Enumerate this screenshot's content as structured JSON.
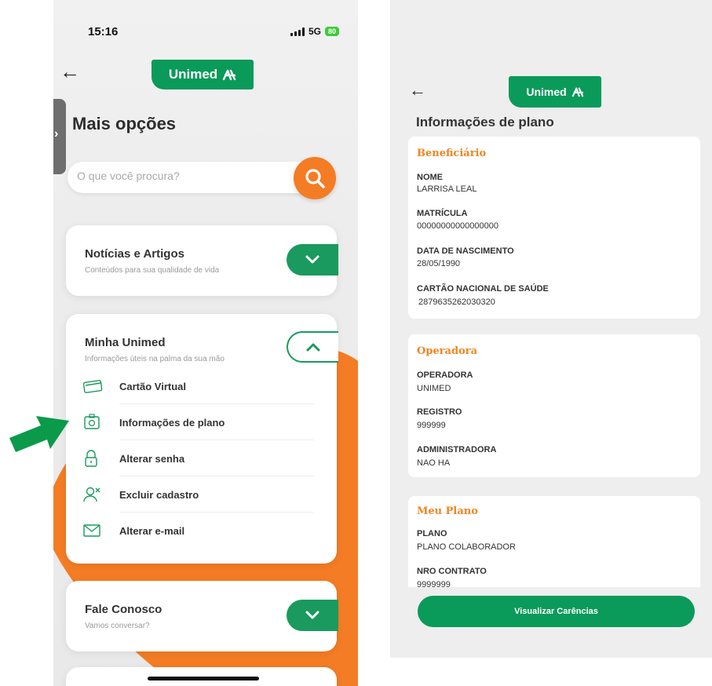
{
  "left_screen": {
    "status": {
      "time": "15:16",
      "network": "5G",
      "battery": "80"
    },
    "logo_text": "Unimed",
    "page_title": "Mais opções",
    "search": {
      "placeholder": "O que você procura?"
    },
    "cards": {
      "noticias": {
        "title": "Notícias e Artigos",
        "subtitle": "Conteúdos para sua qualidade de vida"
      },
      "minha_unimed": {
        "title": "Minha Unimed",
        "subtitle": "Informações úteis na palma da sua mão",
        "items": [
          {
            "label": "Cartão Virtual",
            "icon": "card-icon"
          },
          {
            "label": "Informações de plano",
            "icon": "id-badge-icon"
          },
          {
            "label": "Alterar senha",
            "icon": "lock-icon"
          },
          {
            "label": "Excluir cadastro",
            "icon": "user-remove-icon"
          },
          {
            "label": "Alterar e-mail",
            "icon": "mail-icon"
          }
        ]
      },
      "fale_conosco": {
        "title": "Fale Conosco",
        "subtitle": "Vamos conversar?"
      }
    }
  },
  "right_screen": {
    "logo_text": "Unimed",
    "page_title": "Informações de plano",
    "beneficiario": {
      "title": "Beneficiário",
      "fields": [
        {
          "label": "NOME",
          "value": "LARRISA LEAL"
        },
        {
          "label": "MATRÍCULA",
          "value": "00000000000000000"
        },
        {
          "label": "DATA DE NASCIMENTO",
          "value": "28/05/1990"
        },
        {
          "label": "CARTÃO NACIONAL DE SAÚDE",
          "value": "2879635262030320"
        }
      ]
    },
    "operadora": {
      "title": "Operadora",
      "fields": [
        {
          "label": "OPERADORA",
          "value": "UNIMED"
        },
        {
          "label": "REGISTRO",
          "value": "999999"
        },
        {
          "label": "ADMINISTRADORA",
          "value": "NAO HA"
        }
      ]
    },
    "meu_plano": {
      "title": "Meu Plano",
      "fields": [
        {
          "label": "PLANO",
          "value": "PLANO COLABORADOR"
        },
        {
          "label": "NRO CONTRATO",
          "value": "9999999"
        }
      ]
    },
    "cta_label": "Visualizar Carências"
  },
  "colors": {
    "brand_green": "#0a9a5a",
    "accent_orange": "#f47c24",
    "section_orange": "#ef8623"
  }
}
